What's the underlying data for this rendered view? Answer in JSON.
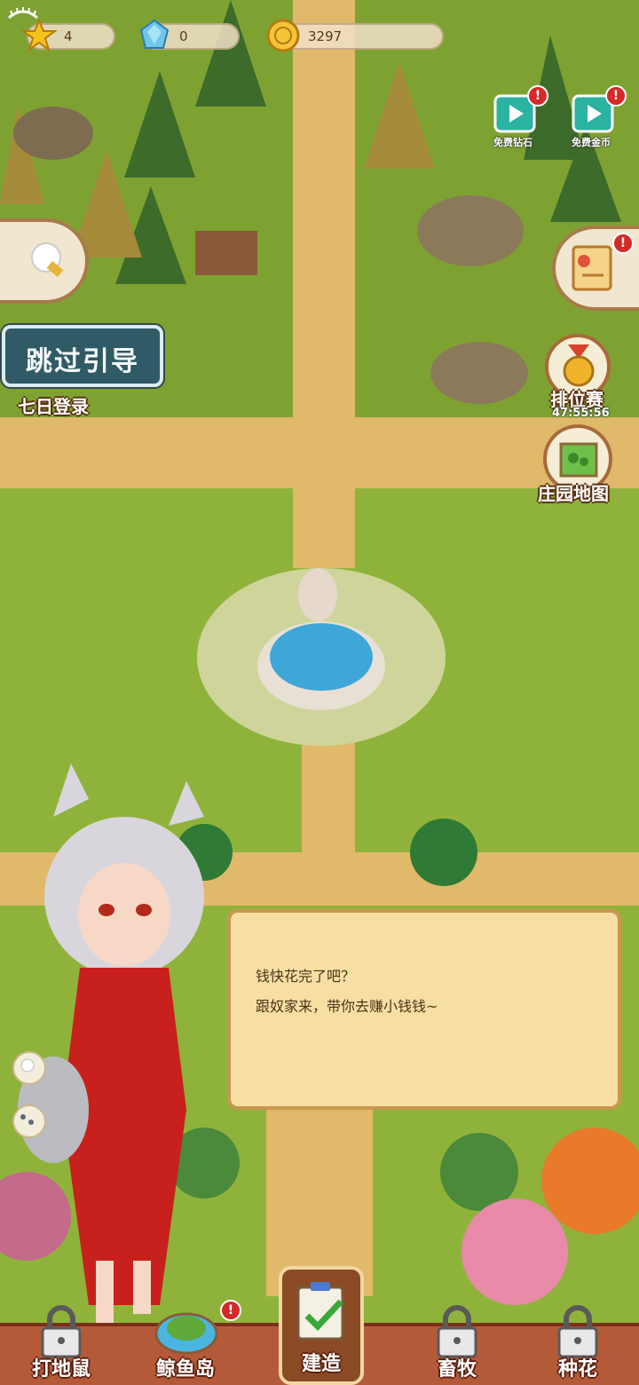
{
  "resources": {
    "stars": "4",
    "diamonds": "0",
    "coins": "3297"
  },
  "top_right": {
    "free_diamond_label": "免费钻石",
    "free_coin_label": "免费金币"
  },
  "left_panel": {
    "skip_guide": "跳过引导",
    "seven_day_login": "七日登录"
  },
  "right_panel": {
    "ranking_label": "排位赛",
    "ranking_timer": "47:55:56",
    "manor_map_label": "庄园地图"
  },
  "dialog": {
    "line1": "钱快花完了吧？",
    "line2": "跟奴家来，带你去赚小钱钱~"
  },
  "bottom_nav": {
    "whack_mole": "打地鼠",
    "whale_island": "鲸鱼岛",
    "build": "建造",
    "livestock": "畜牧",
    "plant_flowers": "种花"
  },
  "alert_mark": "!"
}
